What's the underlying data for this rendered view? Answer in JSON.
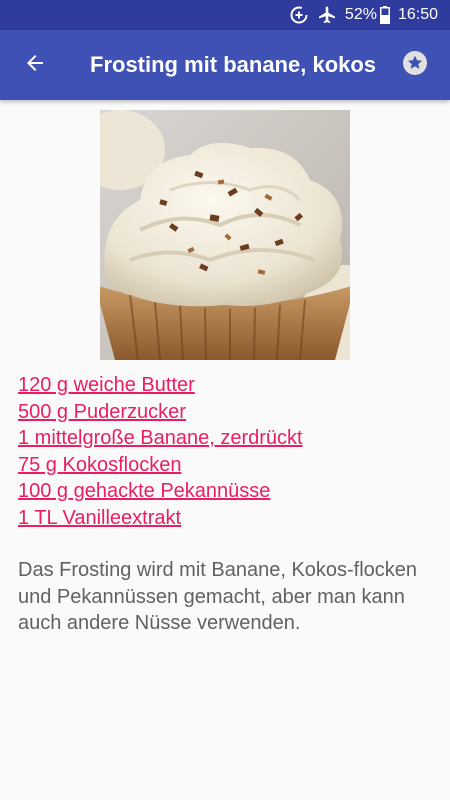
{
  "status_bar": {
    "battery_percent": "52%",
    "time": "16:50",
    "icons": [
      "data-saver-icon",
      "airplane-mode-icon",
      "battery-icon"
    ]
  },
  "app_bar": {
    "title": "Frosting mit banane, kokos",
    "back_icon": "arrow-back-icon",
    "favorite_icon": "star-icon"
  },
  "recipe": {
    "image_alt": "cupcake",
    "ingredients": [
      "120 g weiche Butter",
      "500 g Puderzucker",
      "1 mittelgroße Banane, zerdrückt",
      "75 g Kokosflocken",
      "100 g gehackte Pekannüsse",
      "1 TL Vanilleextrakt"
    ],
    "description": "Das Frosting wird mit Banane, Kokos-flocken und Pekannüssen gemacht, aber man kann auch andere Nüsse verwenden."
  },
  "colors": {
    "status_bar": "#2f3c9e",
    "app_bar": "#3f51b5",
    "link": "#e91e63",
    "text": "#616161",
    "background": "#fafafa"
  }
}
